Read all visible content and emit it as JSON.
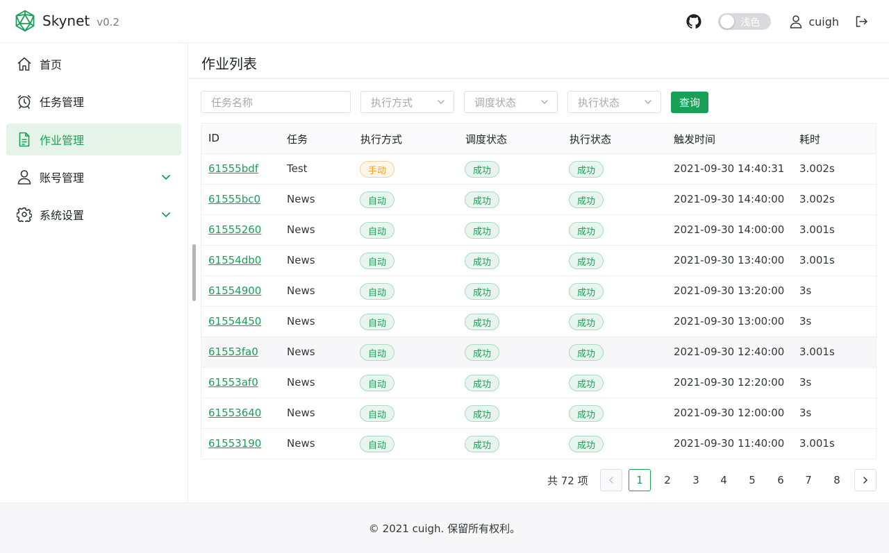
{
  "brand": {
    "name": "Skynet",
    "version": "v0.2"
  },
  "header": {
    "theme_label": "浅色",
    "username": "cuigh"
  },
  "sidebar": {
    "items": [
      {
        "label": "首页",
        "icon": "home-icon"
      },
      {
        "label": "任务管理",
        "icon": "alarm-clock-icon"
      },
      {
        "label": "作业管理",
        "icon": "document-icon",
        "active": true
      },
      {
        "label": "账号管理",
        "icon": "user-icon",
        "expandable": true
      },
      {
        "label": "系统设置",
        "icon": "gear-icon",
        "expandable": true
      }
    ]
  },
  "page": {
    "title": "作业列表"
  },
  "filters": {
    "task_name_placeholder": "任务名称",
    "mode_placeholder": "执行方式",
    "dispatch_placeholder": "调度状态",
    "exec_placeholder": "执行状态",
    "search_label": "查询"
  },
  "table": {
    "headers": [
      "ID",
      "任务",
      "执行方式",
      "调度状态",
      "执行状态",
      "触发时间",
      "耗时"
    ],
    "rows": [
      {
        "id": "61555bdf",
        "task": "Test",
        "mode": "手动",
        "dispatch": "成功",
        "exec": "成功",
        "time": "2021-09-30 14:40:31",
        "cost": "3.002s"
      },
      {
        "id": "61555bc0",
        "task": "News",
        "mode": "自动",
        "dispatch": "成功",
        "exec": "成功",
        "time": "2021-09-30 14:40:00",
        "cost": "3.002s"
      },
      {
        "id": "61555260",
        "task": "News",
        "mode": "自动",
        "dispatch": "成功",
        "exec": "成功",
        "time": "2021-09-30 14:00:00",
        "cost": "3.001s"
      },
      {
        "id": "61554db0",
        "task": "News",
        "mode": "自动",
        "dispatch": "成功",
        "exec": "成功",
        "time": "2021-09-30 13:40:00",
        "cost": "3.001s"
      },
      {
        "id": "61554900",
        "task": "News",
        "mode": "自动",
        "dispatch": "成功",
        "exec": "成功",
        "time": "2021-09-30 13:20:00",
        "cost": "3s"
      },
      {
        "id": "61554450",
        "task": "News",
        "mode": "自动",
        "dispatch": "成功",
        "exec": "成功",
        "time": "2021-09-30 13:00:00",
        "cost": "3s"
      },
      {
        "id": "61553fa0",
        "task": "News",
        "mode": "自动",
        "dispatch": "成功",
        "exec": "成功",
        "time": "2021-09-30 12:40:00",
        "cost": "3.001s"
      },
      {
        "id": "61553af0",
        "task": "News",
        "mode": "自动",
        "dispatch": "成功",
        "exec": "成功",
        "time": "2021-09-30 12:20:00",
        "cost": "3s"
      },
      {
        "id": "61553640",
        "task": "News",
        "mode": "自动",
        "dispatch": "成功",
        "exec": "成功",
        "time": "2021-09-30 12:00:00",
        "cost": "3s"
      },
      {
        "id": "61553190",
        "task": "News",
        "mode": "自动",
        "dispatch": "成功",
        "exec": "成功",
        "time": "2021-09-30 11:40:00",
        "cost": "3.001s"
      }
    ]
  },
  "pagination": {
    "total_label": "共 72 项",
    "pages": [
      "1",
      "2",
      "3",
      "4",
      "5",
      "6",
      "7",
      "8"
    ],
    "current": "1"
  },
  "footer": {
    "text": "© 2021 cuigh. 保留所有权利。"
  },
  "colors": {
    "accent": "#18a058",
    "warning": "#f0a020"
  }
}
